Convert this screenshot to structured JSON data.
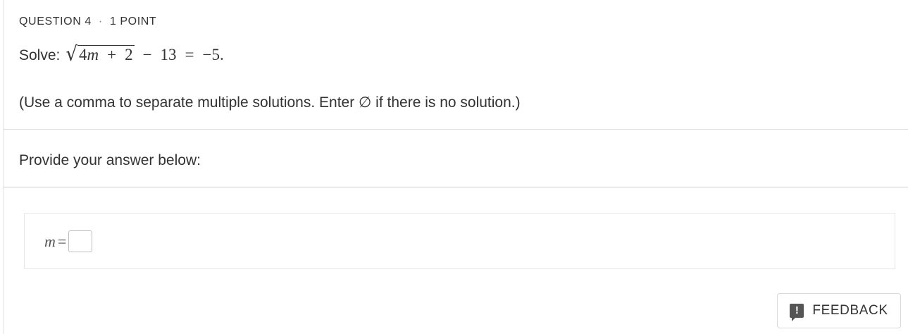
{
  "header": {
    "question_label": "QUESTION 4",
    "separator": "·",
    "points": "1 POINT"
  },
  "prompt": {
    "label": "Solve:",
    "radicand_coef": "4",
    "radicand_var": "m",
    "radicand_op": "+",
    "radicand_const": "2",
    "minus": "−",
    "subtrahend": "13",
    "equals": "=",
    "rhs": "−5."
  },
  "instructions": "(Use a comma to separate multiple solutions. Enter ∅ if there is no solution.)",
  "answer_section": {
    "heading": "Provide your answer below:",
    "variable": "m",
    "equals": "=",
    "input_value": ""
  },
  "feedback": {
    "label": "FEEDBACK",
    "icon_glyph": "!"
  }
}
